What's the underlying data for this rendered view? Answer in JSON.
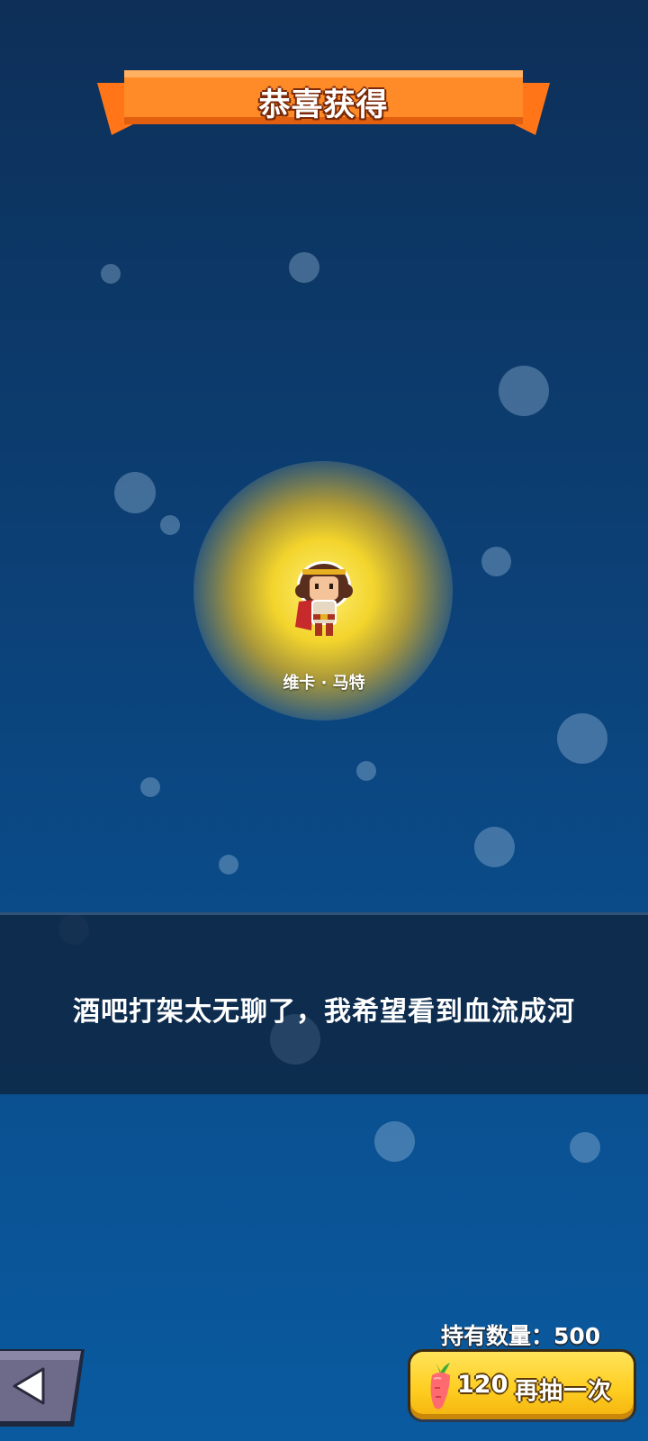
{
  "banner": {
    "title": "恭喜获得"
  },
  "reward": {
    "character_name": "维卡 · 马特"
  },
  "quote": {
    "text": "酒吧打架太无聊了，我希望看到血流成河"
  },
  "footer": {
    "hold_count_label": "持有数量：500",
    "draw_button": {
      "cost": "120",
      "label": "再抽一次",
      "cost_icon": "carrot-icon"
    },
    "back_icon": "back-arrow-icon"
  },
  "colors": {
    "banner_orange": "#ff7a22",
    "button_yellow": "#ffd22a",
    "quote_panel": "#0e2846"
  }
}
